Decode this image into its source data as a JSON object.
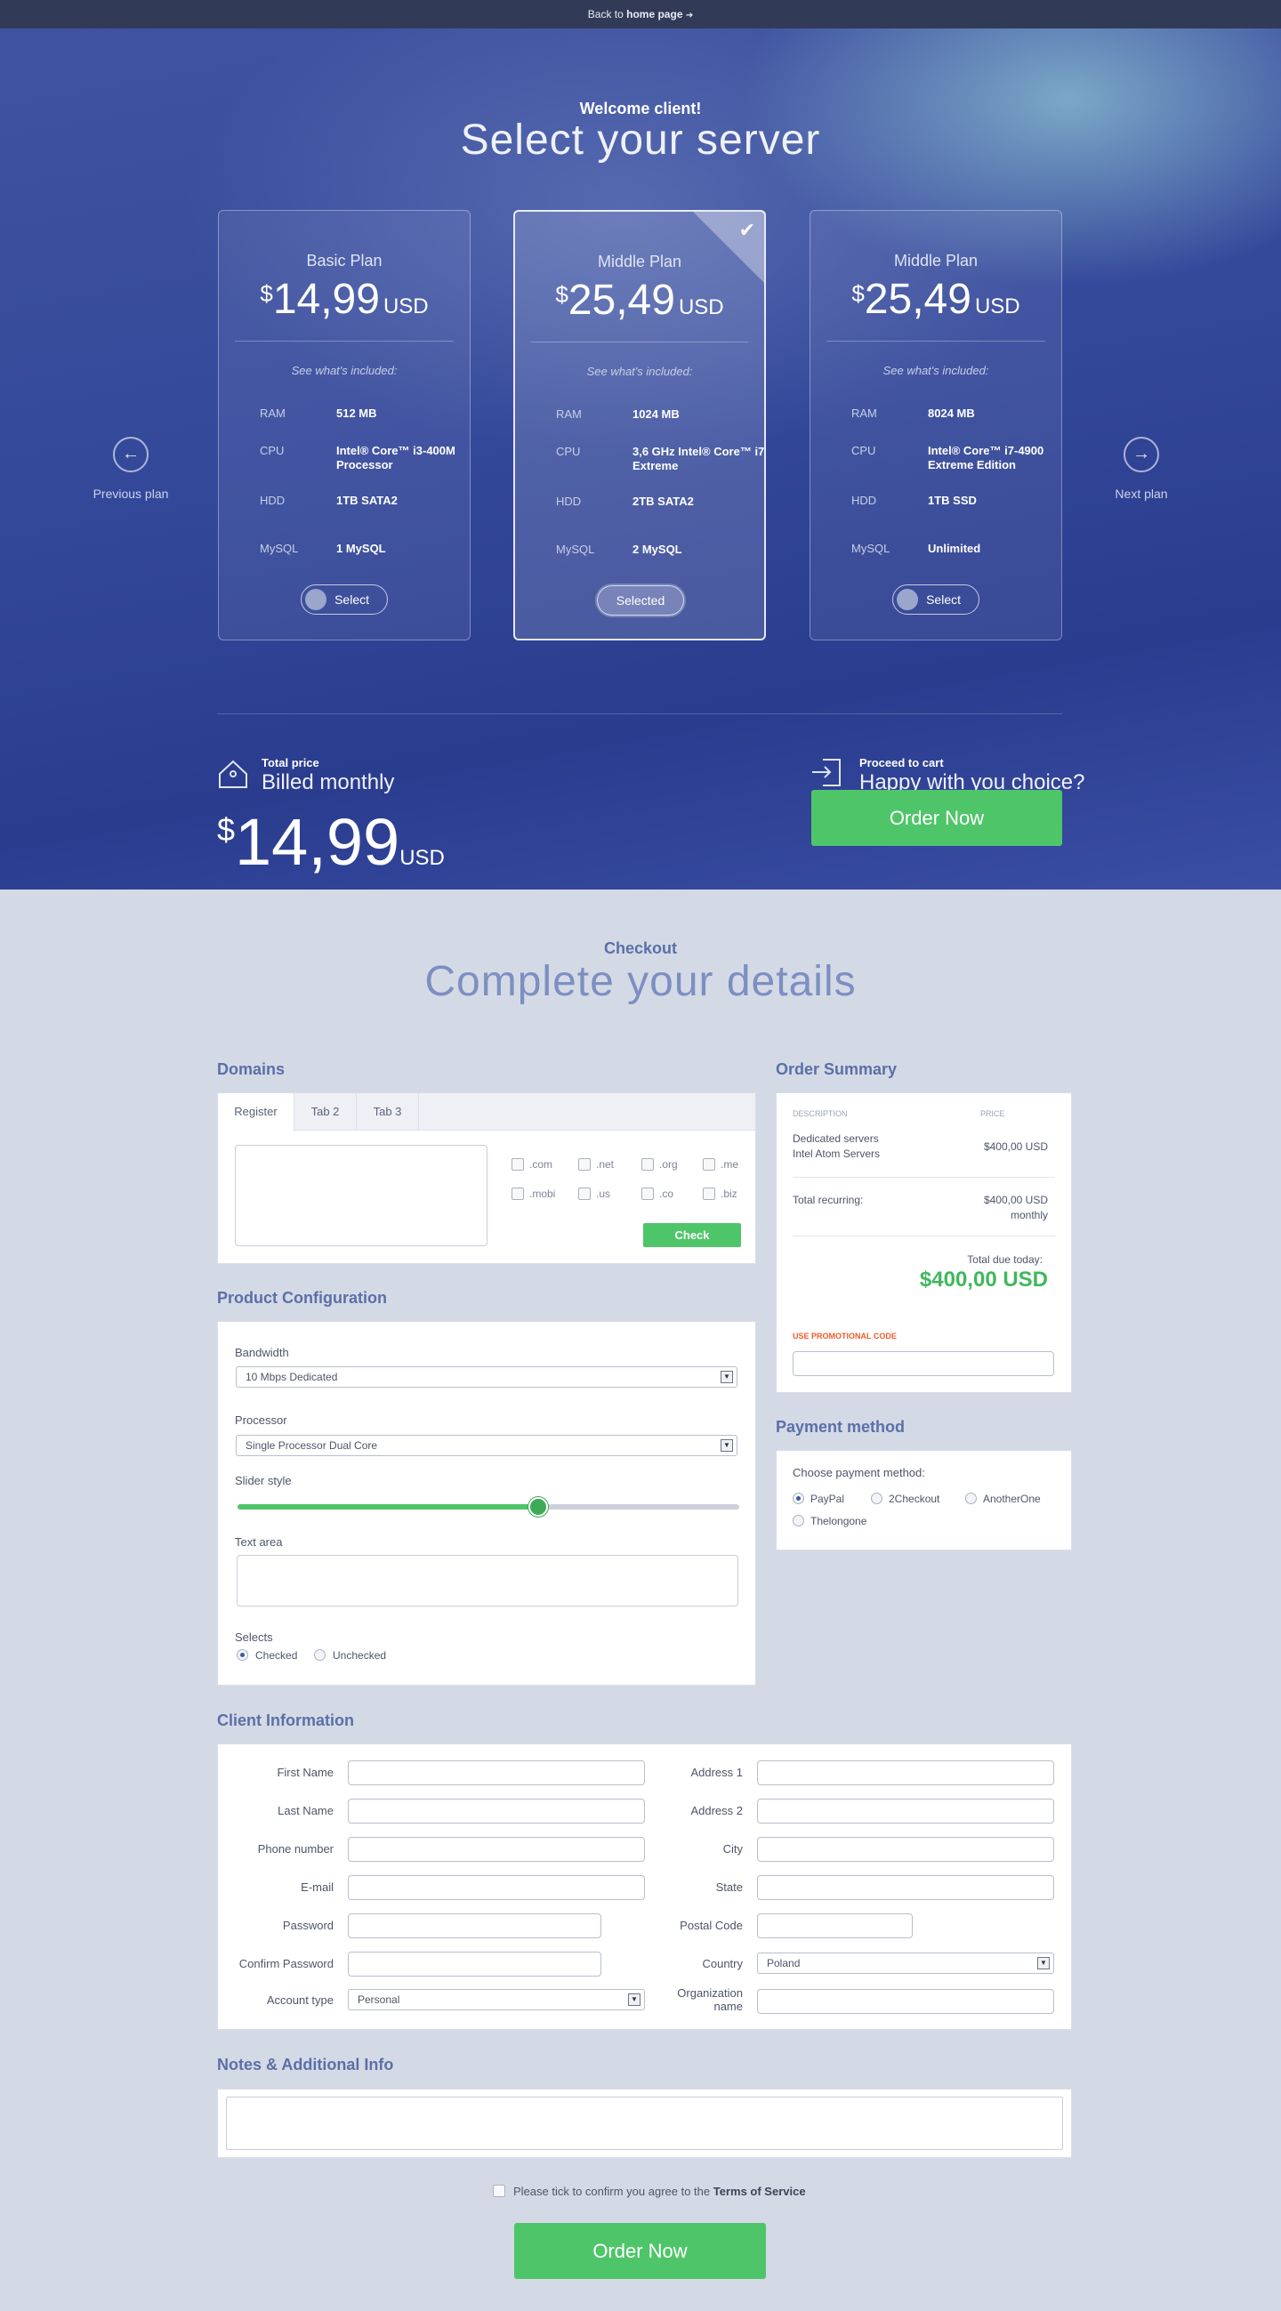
{
  "topbar": {
    "prefix": "Back to",
    "link": "home page",
    "arrow": "➔"
  },
  "hero": {
    "welcome": "Welcome client!",
    "title": "Select your server",
    "see_included": "See what's included:",
    "prev_label": "Previous plan",
    "next_label": "Next plan",
    "plans": [
      {
        "name": "Basic Plan",
        "currency_symbol": "$",
        "price": "14,99",
        "currency": "USD",
        "specs": [
          {
            "k": "RAM",
            "v": "512 MB"
          },
          {
            "k": "CPU",
            "v": "Intel® Core™ i3-400M Processor"
          },
          {
            "k": "HDD",
            "v": "1TB SATA2"
          },
          {
            "k": "MySQL",
            "v": "1 MySQL"
          }
        ],
        "button": "Select",
        "selected": false
      },
      {
        "name": "Middle Plan",
        "currency_symbol": "$",
        "price": "25,49",
        "currency": "USD",
        "specs": [
          {
            "k": "RAM",
            "v": "1024 MB"
          },
          {
            "k": "CPU",
            "v": "3,6 GHz Intel® Core™ i7 Extreme"
          },
          {
            "k": "HDD",
            "v": "2TB SATA2"
          },
          {
            "k": "MySQL",
            "v": "2 MySQL"
          }
        ],
        "button": "Selected",
        "selected": true
      },
      {
        "name": "Middle Plan",
        "currency_symbol": "$",
        "price": "25,49",
        "currency": "USD",
        "specs": [
          {
            "k": "RAM",
            "v": "8024 MB"
          },
          {
            "k": "CPU",
            "v": "Intel® Core™ i7-4900 Extreme Edition"
          },
          {
            "k": "HDD",
            "v": "1TB SSD"
          },
          {
            "k": "MySQL",
            "v": "Unlimited"
          }
        ],
        "button": "Select",
        "selected": false
      }
    ],
    "total": {
      "label": "Total price",
      "sub": "Billed monthly",
      "currency_symbol": "$",
      "price": "14,99",
      "currency": "USD"
    },
    "cart": {
      "label": "Proceed to cart",
      "sub": "Happy with you choice?",
      "button": "Order Now"
    }
  },
  "checkout": {
    "label": "Checkout",
    "title": "Complete your details",
    "domains": {
      "heading": "Domains",
      "tabs": [
        "Register",
        "Tab 2",
        "Tab 3"
      ],
      "tlds": [
        ".com",
        ".net",
        ".org",
        ".me",
        ".mobi",
        ".us",
        ".co",
        ".biz"
      ],
      "check_button": "Check"
    },
    "product": {
      "heading": "Product Configuration",
      "bandwidth_label": "Bandwidth",
      "bandwidth_value": "10 Mbps Dedicated",
      "processor_label": "Processor",
      "processor_value": "Single Processor Dual Core",
      "slider_label": "Slider style",
      "slider_value": 0.6,
      "textarea_label": "Text area",
      "selects_label": "Selects",
      "radio_checked": "Checked",
      "radio_unchecked": "Unchecked"
    },
    "summary": {
      "heading": "Order Summary",
      "col_desc": "DESCRIPTION",
      "col_price": "PRICE",
      "item_line1": "Dedicated servers",
      "item_line2": "Intel Atom Servers",
      "item_price": "$400,00 USD",
      "recurring_label": "Total recurring:",
      "recurring_price": "$400,00 USD",
      "recurring_period": "monthly",
      "due_label": "Total due today:",
      "due_price": "$400,00 USD",
      "promo_label": "USE PROMOTIONAL CODE"
    },
    "payment": {
      "heading": "Payment method",
      "choose_label": "Choose payment method:",
      "options": [
        "PayPal",
        "2Checkout",
        "AnotherOne",
        "Thelongone"
      ],
      "selected": "PayPal"
    },
    "client": {
      "heading": "Client Information",
      "left": [
        "First Name",
        "Last Name",
        "Phone number",
        "E-mail",
        "Password",
        "Confirm Password",
        "Account type"
      ],
      "right": [
        "Address 1",
        "Address 2",
        "City",
        "State",
        "Postal Code",
        "Country",
        "Organization name"
      ],
      "account_type_value": "Personal",
      "country_value": "Poland"
    },
    "notes": {
      "heading": "Notes & Additional Info"
    },
    "terms": {
      "prefix": "Please tick to confirm you agree to the",
      "link": "Terms of Service"
    },
    "order_button": "Order Now"
  },
  "colors": {
    "accent_green": "#4fc569",
    "hero_blue": "#34489a",
    "heading_blue": "#5b6fa8"
  }
}
